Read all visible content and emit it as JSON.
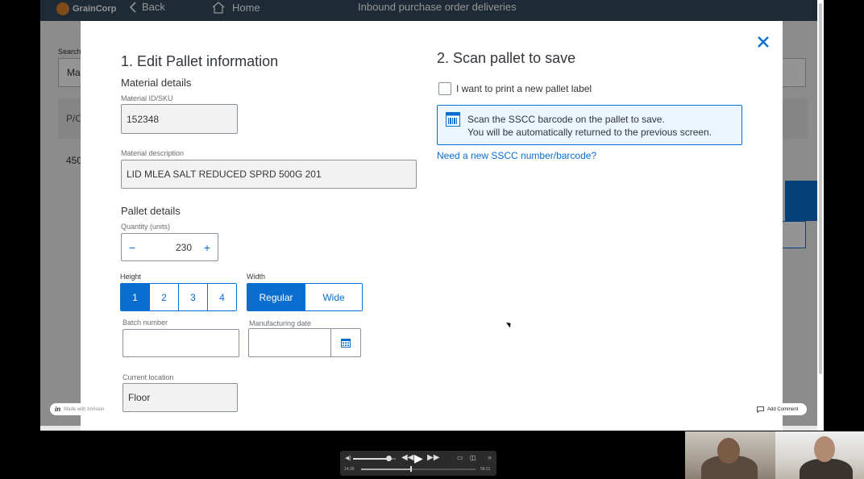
{
  "app": {
    "brand": "GrainCorp",
    "back_label": "Back",
    "home_label": "Home",
    "title": "Inbound purchase order deliveries",
    "bg_search_label": "Search",
    "bg_search_value": "Ma",
    "bg_col_header": "P/C",
    "bg_row_value": "450"
  },
  "dialog": {
    "left": {
      "title": "1. Edit Pallet information",
      "material_details_heading": "Material details",
      "material_id_label": "Material ID/SKU",
      "material_id_value": "152348",
      "material_desc_label": "Material description",
      "material_desc_value": "LID MLEA SALT REDUCED SPRD 500G 201",
      "pallet_details_heading": "Pallet details",
      "quantity_label": "Quantity (units)",
      "quantity_value": "230",
      "minus_symbol": "−",
      "plus_symbol": "+",
      "height_label": "Height",
      "height_options": [
        "1",
        "2",
        "3",
        "4"
      ],
      "height_selected": "1",
      "width_label": "Width",
      "width_options": [
        "Regular",
        "Wide"
      ],
      "width_selected": "Regular",
      "batch_label": "Batch number",
      "batch_value": "",
      "mfg_date_label": "Manufacturing date",
      "mfg_date_value": "",
      "location_label": "Current location",
      "location_value": "Floor"
    },
    "right": {
      "title": "2. Scan pallet to save",
      "checkbox_label": "I want to print a new pallet label",
      "checkbox_checked": false,
      "info_line1": "Scan the SSCC barcode on the pallet to save.",
      "info_line2": "You will be automatically returned to the previous screen.",
      "link_label": "Need a new SSCC number/barcode?"
    }
  },
  "overlay": {
    "made_with_prefix": "in",
    "made_with_text": "Made with InVision",
    "add_comment": "Add Comment"
  },
  "player": {
    "current_time": "14:39",
    "total_time": "58:31",
    "progress_fraction": 0.43,
    "volume_fraction": 0.85
  },
  "colors": {
    "accent": "#0a6ed1",
    "shell": "#354a5f",
    "info_bg": "#ebf5fe"
  }
}
